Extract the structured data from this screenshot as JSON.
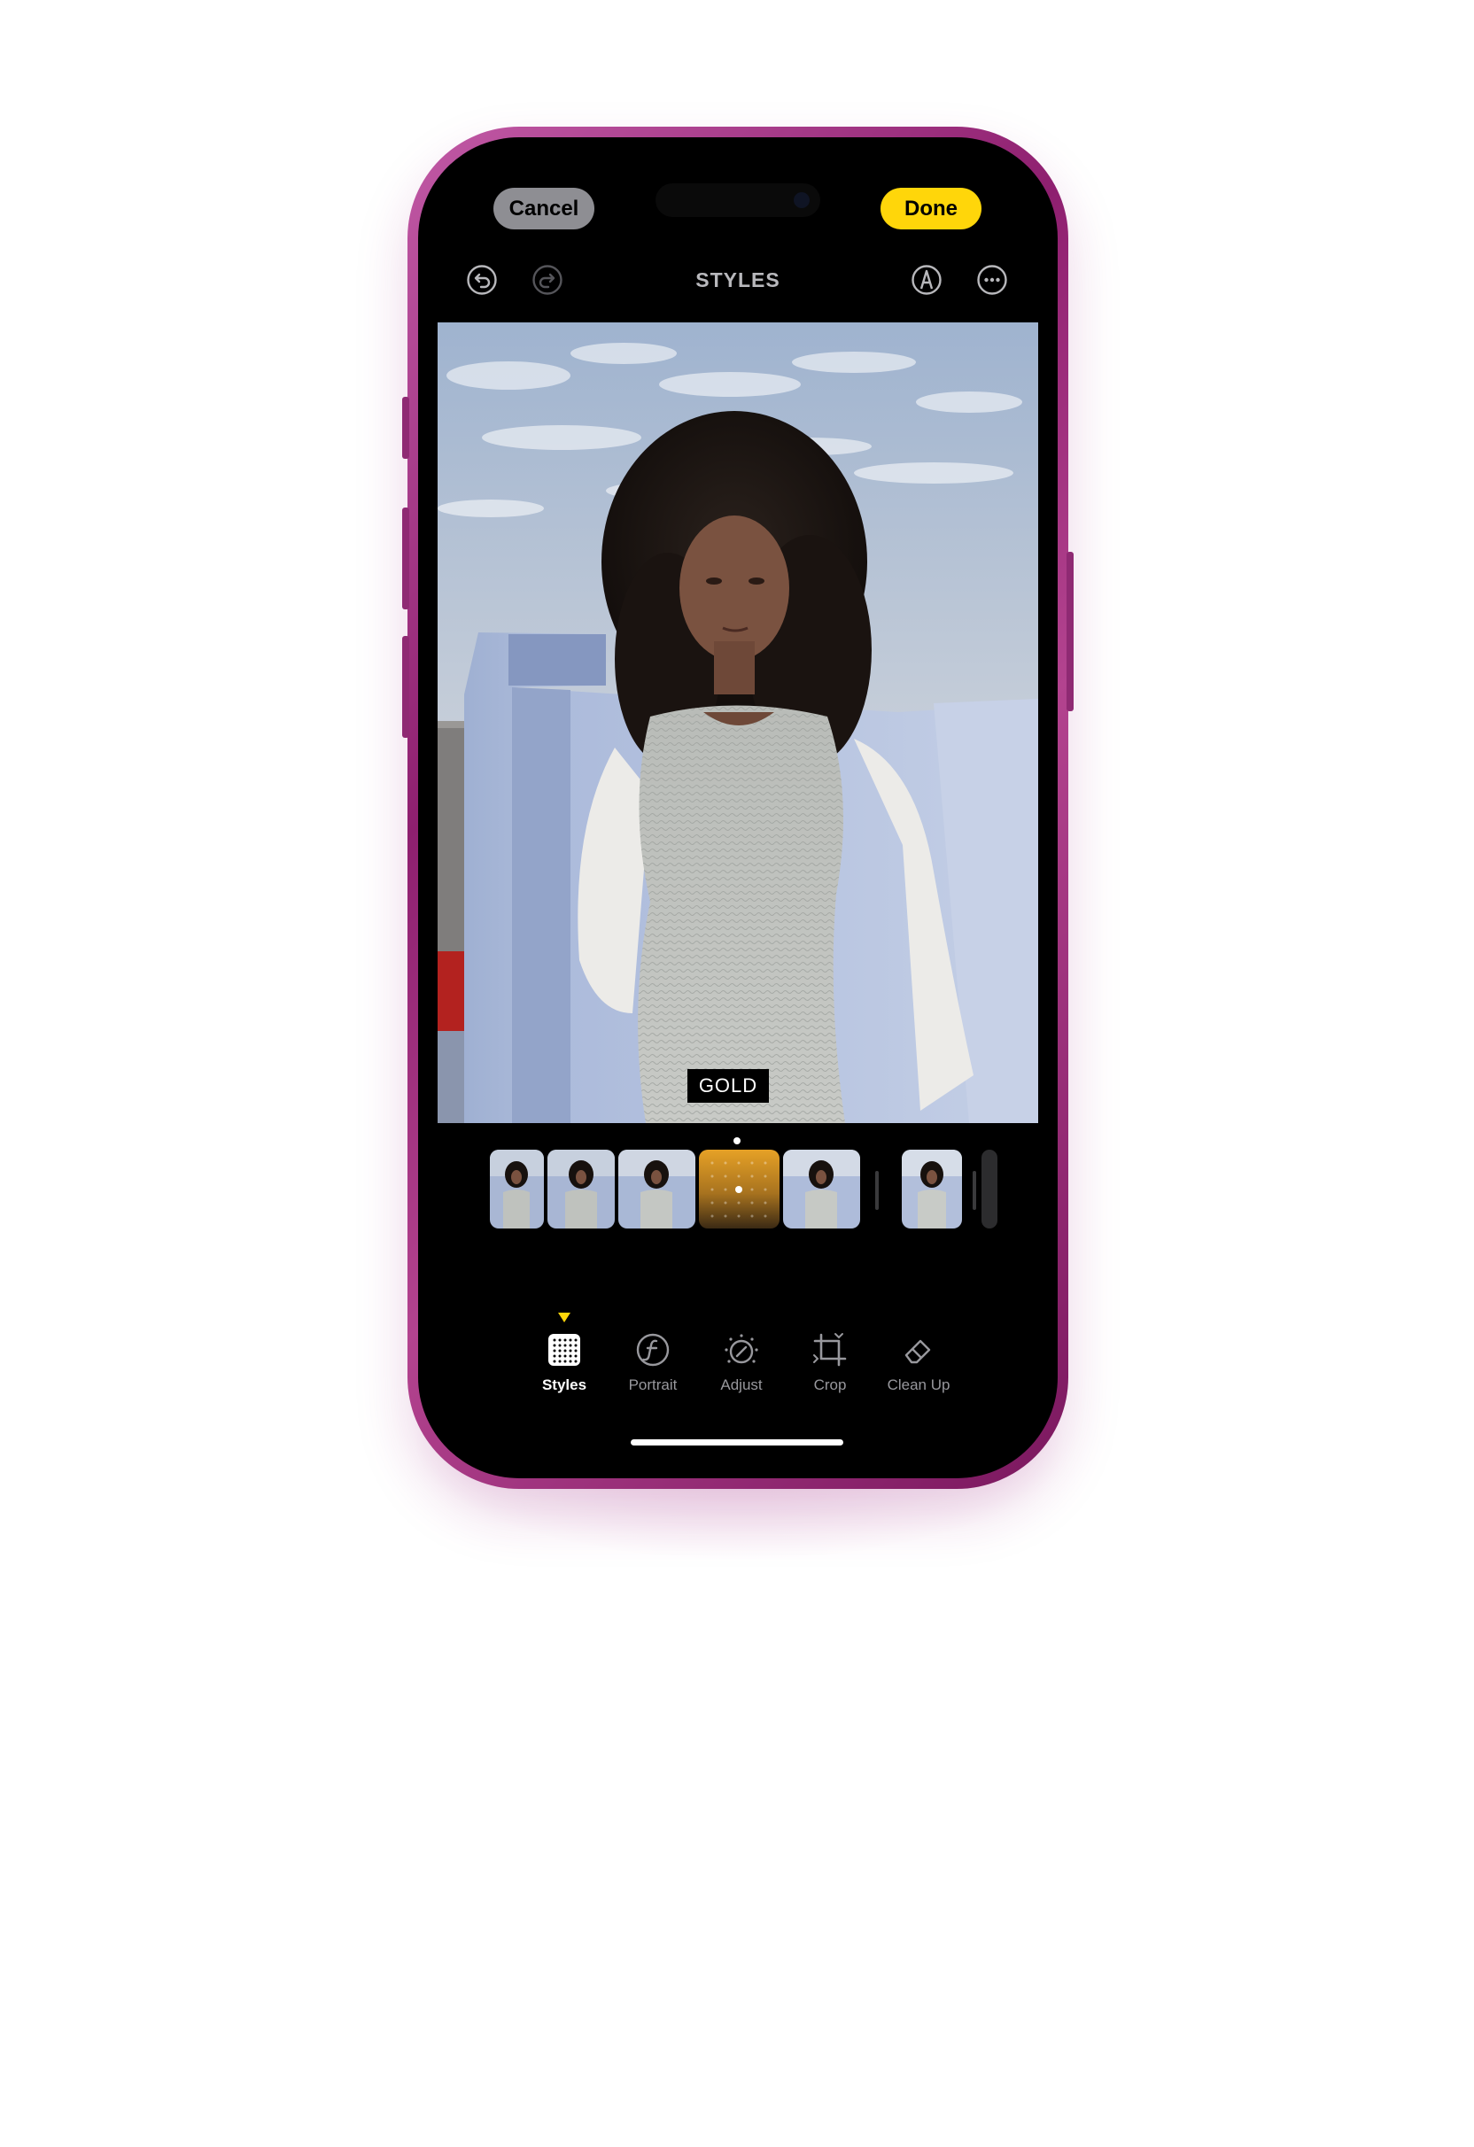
{
  "header": {
    "cancel_label": "Cancel",
    "done_label": "Done",
    "title": "STYLES"
  },
  "toolbar_icons": [
    "undo-icon",
    "redo-icon",
    "markup-icon",
    "more-icon"
  ],
  "photo": {
    "style_badge": "GOLD"
  },
  "style_strip": {
    "thumbnails": 7,
    "selected_index": 3
  },
  "tabs": [
    {
      "label": "Styles",
      "icon": "styles-grid-icon",
      "active": true
    },
    {
      "label": "Portrait",
      "icon": "portrait-f-icon",
      "active": false
    },
    {
      "label": "Adjust",
      "icon": "adjust-dial-icon",
      "active": false
    },
    {
      "label": "Crop",
      "icon": "crop-icon",
      "active": false
    },
    {
      "label": "Clean Up",
      "icon": "eraser-icon",
      "active": false
    }
  ],
  "colors": {
    "frame": "#a23a84",
    "accent": "#ffd60a",
    "screen": "#000000"
  }
}
